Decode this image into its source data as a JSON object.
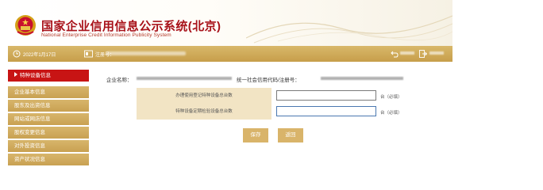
{
  "header": {
    "title": "国家企业信用信息公示系统(北京)",
    "subtitle": "National Enterprise Credit Information Publicity System"
  },
  "statusbar": {
    "date": "2022年1月17日",
    "reg_label": "注册号："
  },
  "sidebar": {
    "items": [
      {
        "label": "特种设备信息",
        "active": true
      },
      {
        "label": "企业基本信息",
        "active": false
      },
      {
        "label": "股东及出资信息",
        "active": false
      },
      {
        "label": "网站或网店信息",
        "active": false
      },
      {
        "label": "股权变更信息",
        "active": false
      },
      {
        "label": "对外投资信息",
        "active": false
      },
      {
        "label": "资产状况信息",
        "active": false
      }
    ]
  },
  "company": {
    "name_label": "企业名称：",
    "credit_label": "统一社会信用代码/注册号："
  },
  "form": {
    "rows": [
      {
        "label": "办理使用登记特种设备总台数",
        "value": "",
        "unit": "台（必填）"
      },
      {
        "label": "特种设备定期检验设备总台数",
        "value": "",
        "unit": "台（必填）"
      }
    ]
  },
  "buttons": {
    "save": "保存",
    "back": "返回"
  },
  "colors": {
    "brand_red": "#a8121a",
    "gold": "#c9a152",
    "active_red": "#c81414",
    "label_bg": "#f2e4c4"
  }
}
